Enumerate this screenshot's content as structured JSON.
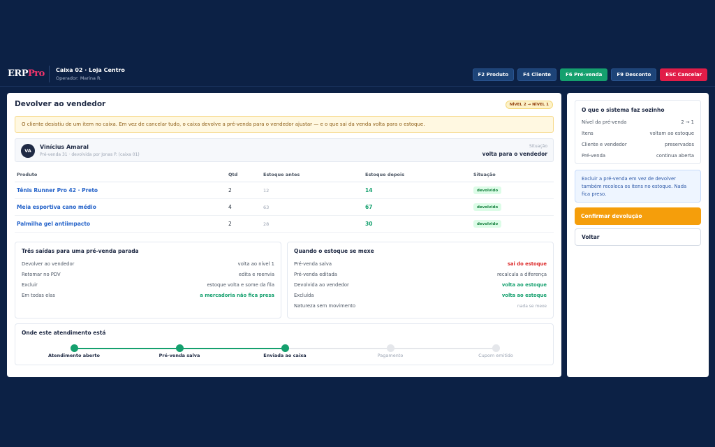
{
  "header": {
    "logo_main": "ERP",
    "logo_accent": "Pro",
    "title": "Caixa 02 · Loja Centro",
    "operator": "Operador: Marina R.",
    "hotkeys": [
      {
        "label": "F2 Produto"
      },
      {
        "label": "F4 Cliente"
      },
      {
        "label": "F6 Pré-venda"
      },
      {
        "label": "F9 Desconto"
      },
      {
        "label": "ESC Cancelar"
      }
    ]
  },
  "main": {
    "title": "Devolver ao vendedor",
    "level_badge": "NÍVEL 2 → NÍVEL 1",
    "notice": "O cliente desistiu de um item no caixa. Em vez de cancelar tudo, o caixa devolve a pré-venda para o vendedor ajustar — e o que sai da venda volta para o estoque.",
    "customer": {
      "initials": "VA",
      "name": "Vinícius Amaral",
      "sub": "Pré-venda 31 · devolvida por Jonas P. (caixa 01)",
      "situation_label": "Situação",
      "situation_value": "volta para o vendedor"
    },
    "table": {
      "headers": [
        "Produto",
        "Qtd",
        "Estoque antes",
        "Estoque depois",
        "Situação"
      ],
      "rows": [
        {
          "product": "Tênis Runner Pro 42 · Preto",
          "qty": "2",
          "before": "12",
          "after": "14",
          "status": "devolvido"
        },
        {
          "product": "Meia esportiva cano médio",
          "qty": "4",
          "before": "63",
          "after": "67",
          "status": "devolvido"
        },
        {
          "product": "Palmilha gel antiimpacto",
          "qty": "2",
          "before": "28",
          "after": "30",
          "status": "devolvido"
        }
      ]
    },
    "exits": {
      "title": "Três saídas para uma pré-venda parada",
      "rows": [
        {
          "label": "Devolver ao vendedor",
          "value": "volta ao nível 1"
        },
        {
          "label": "Retomar no PDV",
          "value": "edita e reenvia"
        },
        {
          "label": "Excluir",
          "value": "estoque volta e some da fila"
        },
        {
          "label": "Em todas elas",
          "value": "a mercadoria não fica presa"
        }
      ]
    },
    "stock": {
      "title": "Quando o estoque se mexe",
      "rows": [
        {
          "label": "Pré-venda salva",
          "value": "sai do estoque"
        },
        {
          "label": "Pré-venda editada",
          "value": "recalcula a diferença"
        },
        {
          "label": "Devolvida ao vendedor",
          "value": "volta ao estoque"
        },
        {
          "label": "Excluída",
          "value": "volta ao estoque"
        },
        {
          "label": "Natureza sem movimento",
          "value": "nada se mexe"
        }
      ]
    },
    "progress": {
      "title": "Onde este atendimento está",
      "steps": [
        {
          "label": "Atendimento aberto"
        },
        {
          "label": "Pré-venda salva"
        },
        {
          "label": "Enviada ao caixa"
        },
        {
          "label": "Pagamento"
        },
        {
          "label": "Cupom emitido"
        }
      ],
      "completed": 3
    }
  },
  "side": {
    "auto_title": "O que o sistema faz sozinho",
    "auto_rows": [
      {
        "label": "Nível da pré-venda",
        "value": "2 → 1"
      },
      {
        "label": "Itens",
        "value": "voltam ao estoque"
      },
      {
        "label": "Cliente e vendedor",
        "value": "preservados"
      },
      {
        "label": "Pré-venda",
        "value": "continua aberta"
      }
    ],
    "info": "Excluir a pré-venda em vez de devolver também recoloca os itens no estoque. Nada fica preso.",
    "confirm_label": "Confirmar devolução",
    "back_label": "Voltar"
  }
}
